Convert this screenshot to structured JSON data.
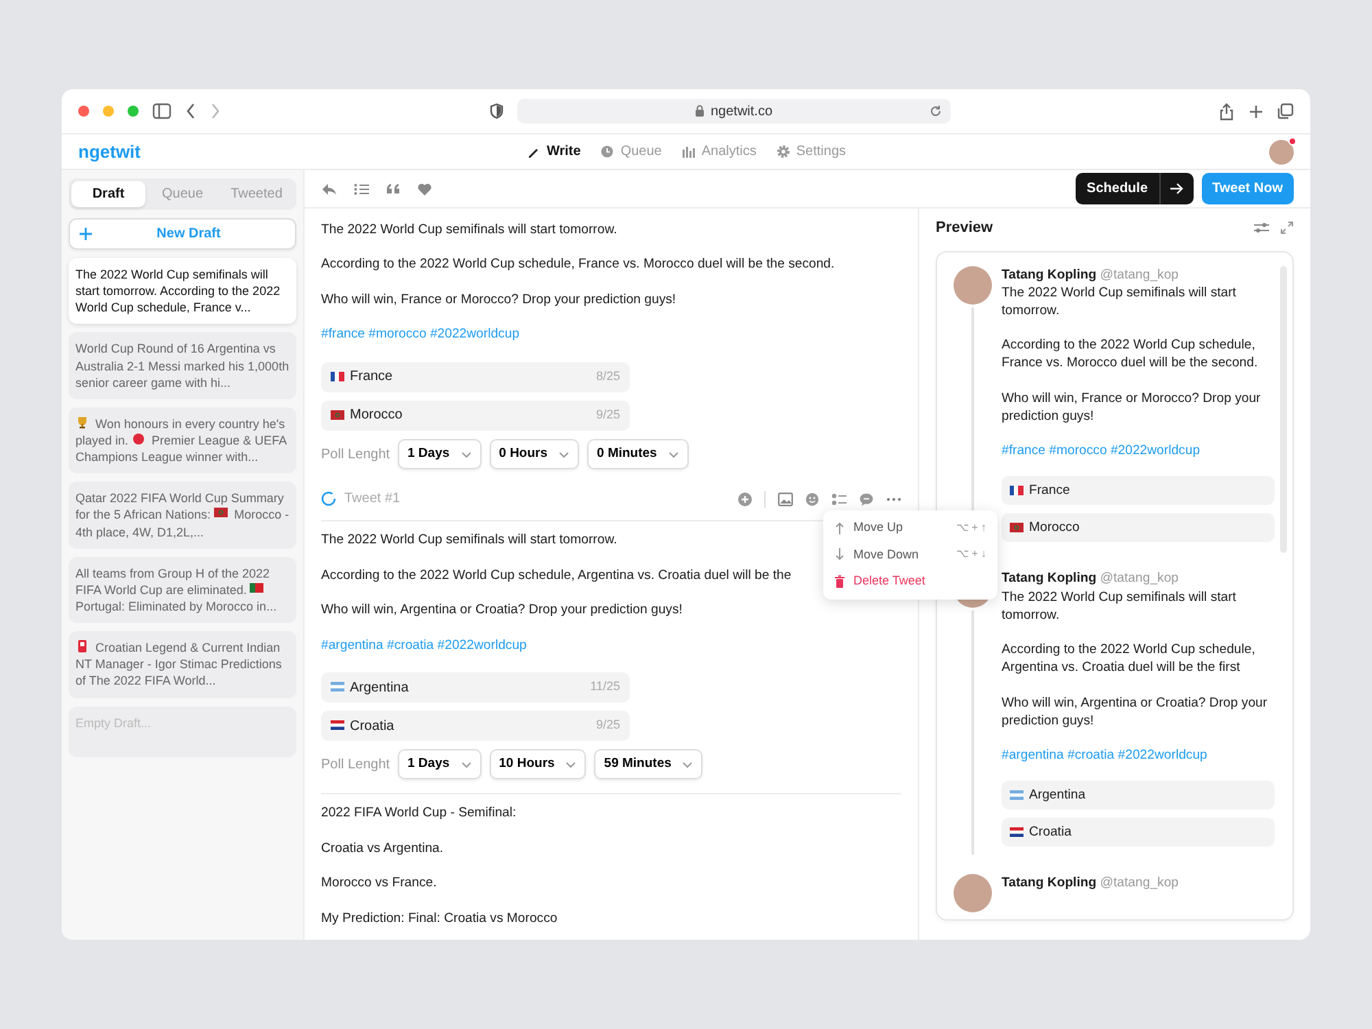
{
  "browser": {
    "url": "ngetwit.co"
  },
  "app": {
    "logo": "ngetwit",
    "nav": [
      {
        "kind": "write",
        "label": "Write",
        "selected": true
      },
      {
        "kind": "queue",
        "label": "Queue",
        "selected": false
      },
      {
        "kind": "analytics",
        "label": "Analytics",
        "selected": false
      },
      {
        "kind": "settings",
        "label": "Settings",
        "selected": false
      }
    ],
    "notification": true
  },
  "sidebar": {
    "tabs": [
      {
        "label": "Draft",
        "selected": true
      },
      {
        "label": "Queue",
        "selected": false
      },
      {
        "label": "Tweeted",
        "selected": false
      }
    ],
    "new_draft": "New Draft",
    "drafts": [
      {
        "kind": "filled",
        "selected": true,
        "segments": [
          {
            "kind": "text",
            "text": "The 2022 World Cup semifinals will start tomorrow. According to the 2022 World Cup schedule, France v..."
          }
        ]
      },
      {
        "kind": "filled",
        "selected": false,
        "segments": [
          {
            "kind": "text",
            "text": "World Cup Round of 16 Argentina vs Australia 2-1 Messi marked his 1,000th senior career game with hi..."
          }
        ]
      },
      {
        "kind": "filled",
        "selected": false,
        "segments": [
          {
            "kind": "trophy"
          },
          {
            "kind": "text",
            "text": "Won honours in every country he's played in."
          },
          {
            "kind": "ball"
          },
          {
            "kind": "text",
            "text": "Premier League & UEFA Champions League winner with..."
          }
        ]
      },
      {
        "kind": "filled",
        "selected": false,
        "segments": [
          {
            "kind": "text",
            "text": "Qatar 2022 FIFA World Cup Summary for the 5 African Nations:"
          },
          {
            "kind": "morocco"
          },
          {
            "kind": "text",
            "text": "Morocco - 4th place, 4W, D1,2L,..."
          }
        ]
      },
      {
        "kind": "filled",
        "selected": false,
        "segments": [
          {
            "kind": "text",
            "text": "All teams from Group H of the 2022 FIFA World Cup are eliminated."
          },
          {
            "kind": "portugal"
          },
          {
            "kind": "text",
            "text": "Portugal: Eliminated by Morocco in..."
          }
        ]
      },
      {
        "kind": "filled",
        "selected": false,
        "segments": [
          {
            "kind": "card"
          },
          {
            "kind": "text",
            "text": "Croatian Legend & Current Indian NT Manager - Igor Stimac Predictions of The 2022 FIFA World..."
          }
        ]
      },
      {
        "kind": "empty",
        "selected": false,
        "placeholder": "Empty Draft..."
      }
    ]
  },
  "editor": {
    "schedule": "Schedule",
    "tweet_now": "Tweet Now",
    "tweets": [
      {
        "paragraphs": [
          "The 2022 World Cup semifinals will start tomorrow.",
          "According to the 2022 World Cup schedule, France vs. Morocco duel will be the second.",
          "Who will win, France or Morocco? Drop your prediction guys!"
        ],
        "hashtags": "#france #morocco #2022worldcup",
        "poll": {
          "options": [
            {
              "kind": "france",
              "label": "France",
              "count": "8/25"
            },
            {
              "kind": "morocco",
              "label": "Morocco",
              "count": "9/25"
            }
          ],
          "length_label": "Poll Lenght",
          "durations": [
            "1 Days",
            "0 Hours",
            "0 Minutes"
          ]
        },
        "footer": {
          "label": "Tweet #1",
          "menu": [
            {
              "kind": "up",
              "label": "Move Up",
              "shortcut": "⌥ + ↑"
            },
            {
              "kind": "down",
              "label": "Move Down",
              "shortcut": "⌥ + ↓"
            },
            {
              "kind": "delete",
              "label": "Delete Tweet"
            }
          ]
        }
      },
      {
        "paragraphs": [
          "The 2022 World Cup semifinals will start tomorrow.",
          "According to the 2022 World Cup schedule, Argentina vs. Croatia duel will be the",
          "Who will win, Argentina or Croatia? Drop your prediction guys!"
        ],
        "hashtags": "#argentina #croatia #2022worldcup",
        "poll": {
          "options": [
            {
              "kind": "argentina",
              "label": "Argentina",
              "count": "11/25"
            },
            {
              "kind": "croatia",
              "label": "Croatia",
              "count": "9/25"
            }
          ],
          "length_label": "Poll Lenght",
          "durations": [
            "1 Days",
            "10 Hours",
            "59 Minutes"
          ]
        }
      },
      {
        "paragraphs": [
          "2022 FIFA World Cup - Semifinal:",
          "Croatia vs Argentina.",
          "Morocco vs France.",
          "My Prediction: Final: Croatia vs Morocco"
        ]
      }
    ]
  },
  "preview": {
    "title": "Preview",
    "tweets": [
      {
        "name": "Tatang Kopling",
        "handle": "@tatang_kop",
        "paragraphs": [
          "The 2022 World Cup semifinals will start tomorrow.",
          "According to the 2022 World Cup schedule, France vs. Morocco duel will be the second.",
          "Who will win, France or Morocco? Drop your prediction guys!"
        ],
        "hashtags": "#france #morocco #2022worldcup",
        "options": [
          {
            "kind": "france",
            "label": "France"
          },
          {
            "kind": "morocco",
            "label": "Morocco"
          }
        ]
      },
      {
        "name": "Tatang Kopling",
        "handle": "@tatang_kop",
        "paragraphs": [
          "The 2022 World Cup semifinals will start tomorrow.",
          "According to the 2022 World Cup schedule, Argentina vs. Croatia duel will be the first",
          "Who will win, Argentina or Croatia? Drop your prediction guys!"
        ],
        "hashtags": "#argentina #croatia #2022worldcup",
        "options": [
          {
            "kind": "argentina",
            "label": "Argentina"
          },
          {
            "kind": "croatia",
            "label": "Croatia"
          }
        ]
      },
      {
        "name": "Tatang Kopling",
        "handle": "@tatang_kop"
      }
    ]
  }
}
